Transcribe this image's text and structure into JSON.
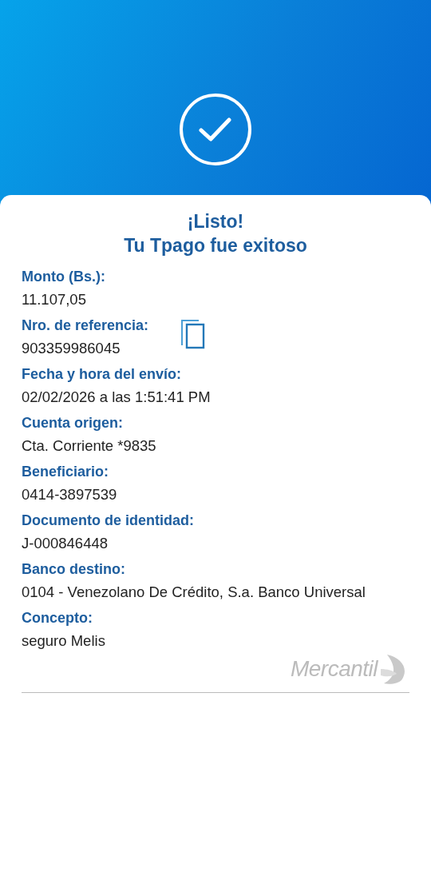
{
  "title": [
    "¡Listo!",
    "Tu Tpago fue exitoso"
  ],
  "fields": [
    {
      "kind": "plain",
      "label": "Monto (Bs.):",
      "value": "11.107,05"
    },
    {
      "kind": "copyable",
      "label": "Nro. de referencia:",
      "value": "903359986045"
    },
    {
      "kind": "plain",
      "label": "Fecha y hora del envío:",
      "value": "02/02/2026 a las 1:51:41 PM"
    },
    {
      "kind": "plain",
      "label": "Cuenta origen:",
      "value": "Cta. Corriente *9835"
    },
    {
      "kind": "plain",
      "label": "Beneficiario:",
      "value": "0414-3897539"
    },
    {
      "kind": "plain",
      "label": "Documento de identidad:",
      "value": "J-000846448"
    },
    {
      "kind": "plain",
      "label": "Banco destino:",
      "value": "0104 - Venezolano De Crédito, S.a. Banco Universal"
    },
    {
      "kind": "plain",
      "label": "Concepto:",
      "value": "seguro Melis"
    }
  ],
  "brand": {
    "name": "Mercantil"
  }
}
